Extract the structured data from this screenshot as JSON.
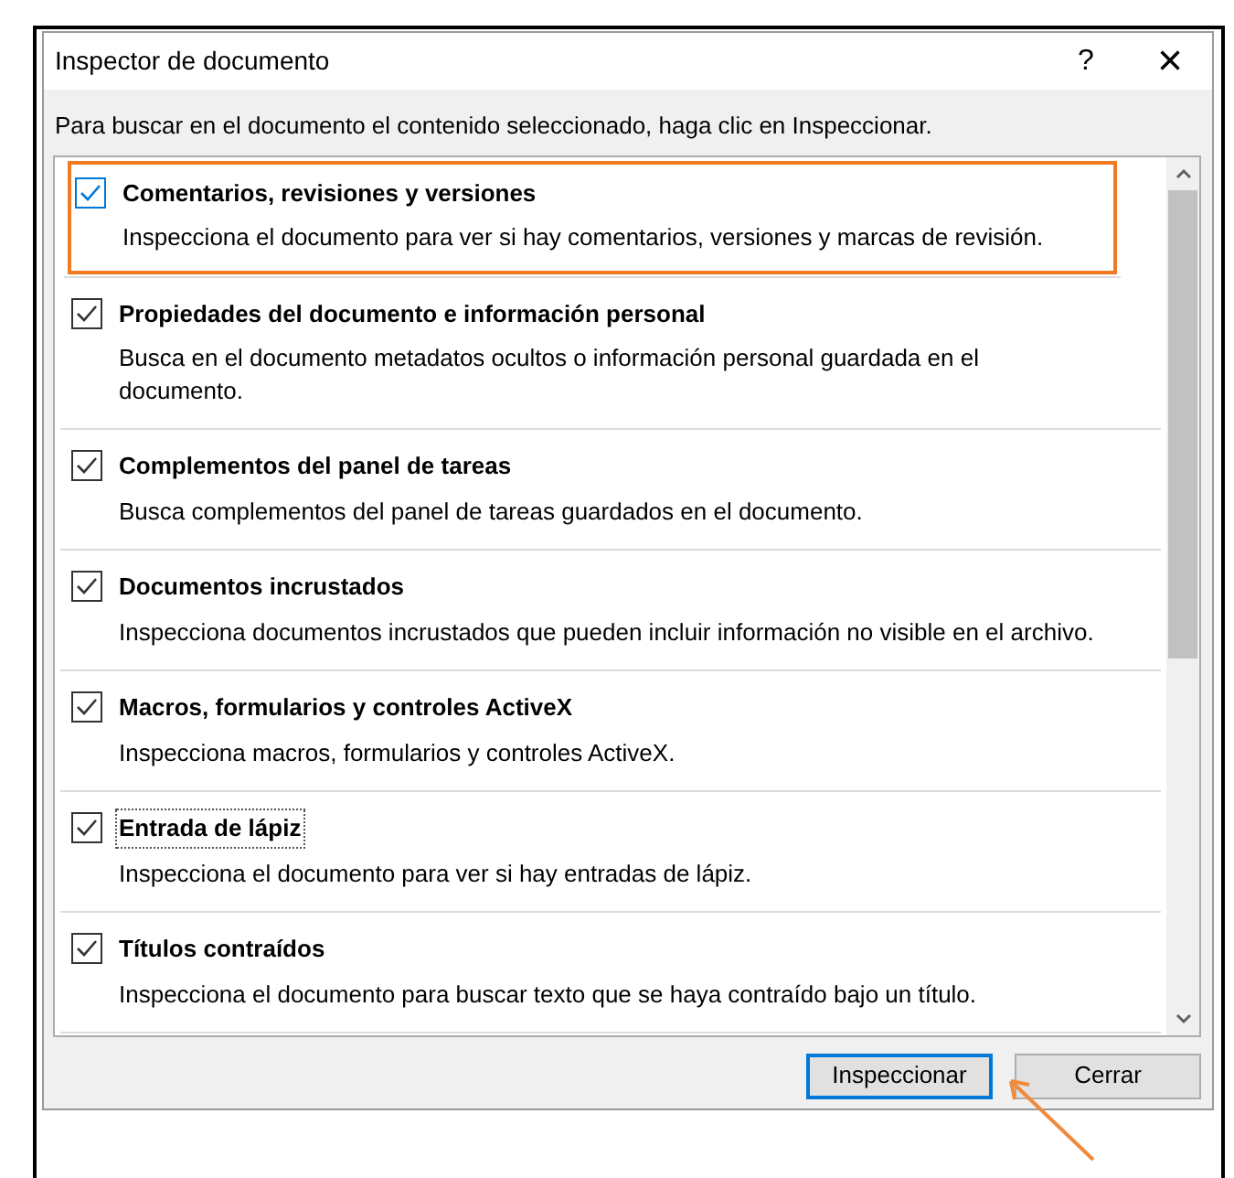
{
  "window": {
    "title": "Inspector de documento",
    "help": "?",
    "close": "×"
  },
  "instruction": "Para buscar en el documento el contenido seleccionado, haga clic en Inspeccionar.",
  "items": [
    {
      "title": "Comentarios, revisiones y versiones",
      "description": "Inspecciona el documento para ver si hay comentarios, versiones y marcas de revisión.",
      "checked": true,
      "hover": true,
      "focused": false,
      "highlighted": true
    },
    {
      "title": "Propiedades del documento e información personal",
      "description": "Busca en el documento metadatos ocultos o información personal guardada en el documento.",
      "checked": true,
      "hover": false,
      "focused": false,
      "highlighted": false
    },
    {
      "title": "Complementos del panel de tareas",
      "description": "Busca complementos del panel de tareas guardados en el documento.",
      "checked": true,
      "hover": false,
      "focused": false,
      "highlighted": false
    },
    {
      "title": "Documentos incrustados",
      "description": "Inspecciona documentos incrustados que pueden incluir información no visible en el archivo.",
      "checked": true,
      "hover": false,
      "focused": false,
      "highlighted": false
    },
    {
      "title": "Macros, formularios y controles ActiveX",
      "description": "Inspecciona macros, formularios y controles ActiveX.",
      "checked": true,
      "hover": false,
      "focused": false,
      "highlighted": false
    },
    {
      "title": "Entrada de lápiz",
      "description": "Inspecciona el documento para ver si hay entradas de lápiz.",
      "checked": true,
      "hover": false,
      "focused": true,
      "highlighted": false
    },
    {
      "title": "Títulos contraídos",
      "description": "Inspecciona el documento para buscar texto que se haya contraído bajo un título.",
      "checked": true,
      "hover": false,
      "focused": false,
      "highlighted": false
    }
  ],
  "buttons": [
    {
      "label": "Inspeccionar",
      "default": true,
      "pointed": true
    },
    {
      "label": "Cerrar",
      "default": false,
      "pointed": false
    }
  ]
}
